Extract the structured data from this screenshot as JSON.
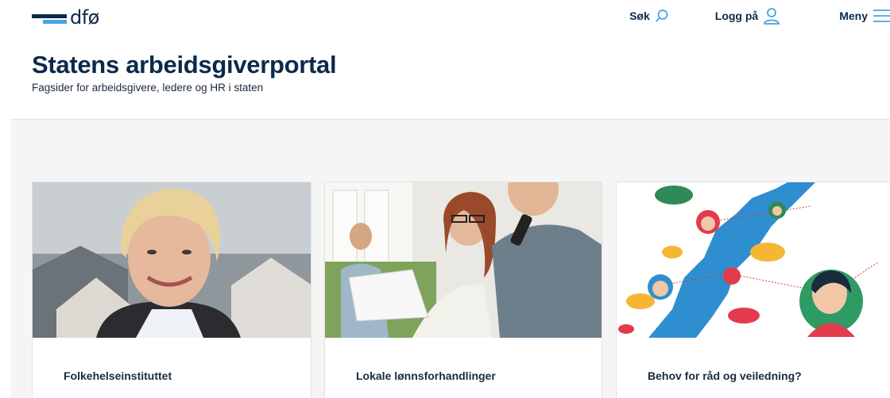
{
  "header": {
    "logo_text": "dfø",
    "nav": {
      "search_label": "Søk",
      "login_label": "Logg på",
      "menu_label": "Meny"
    }
  },
  "hero": {
    "title": "Statens arbeidsgiverportal",
    "subtitle": "Fagsider for arbeidsgivere, ledere og HR i staten"
  },
  "cards": [
    {
      "title": "Folkehelseinstituttet",
      "image": "portrait-photo"
    },
    {
      "title": "Lokale lønnsforhandlinger",
      "image": "meeting-photo"
    },
    {
      "title": "Behov for råd og veiledning?",
      "image": "norway-network-illustration"
    }
  ],
  "colors": {
    "brand_dark": "#0b2a4a",
    "brand_light": "#4aa3df",
    "background_gray": "#f5f5f5"
  }
}
